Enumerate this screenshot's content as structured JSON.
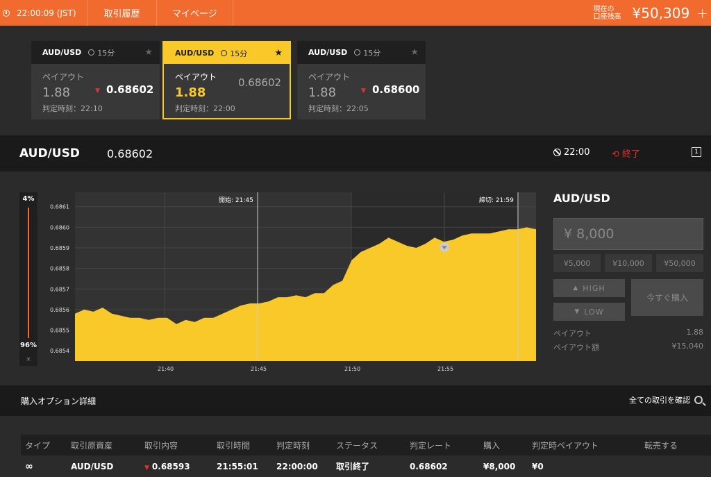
{
  "topbar": {
    "clock": "22:00:09 (JST)",
    "nav": [
      "取引履歴",
      "マイページ"
    ],
    "balance_label_1": "現在の",
    "balance_label_2": "口座残高",
    "balance": "¥50,309",
    "plus": "+"
  },
  "cards": [
    {
      "pair": "AUD/USD",
      "duration": "15分",
      "payout_label": "ペイアウト",
      "payout": "1.88",
      "rate": "0.68602",
      "judge": "判定時刻：22:10",
      "direction": "down",
      "active": false
    },
    {
      "pair": "AUD/USD",
      "duration": "15分",
      "payout_label": "ペイアウト",
      "payout": "1.88",
      "rate": "0.68602",
      "judge": "判定時刻：22:00",
      "direction": "none",
      "active": true
    },
    {
      "pair": "AUD/USD",
      "duration": "15分",
      "payout_label": "ペイアウト",
      "payout": "1.88",
      "rate": "0.68600",
      "judge": "判定時刻：22:05",
      "direction": "down",
      "active": false
    }
  ],
  "pairbar": {
    "pair": "AUD/USD",
    "rate": "0.68602",
    "expiry": "22:00",
    "status": "終了"
  },
  "meter": {
    "high_pct": "4%",
    "low_pct": "96%",
    "close": "×"
  },
  "chart_data": {
    "type": "area",
    "y_ticks": [
      "0.6861",
      "0.6860",
      "0.6859",
      "0.6858",
      "0.6857",
      "0.6856",
      "0.6855",
      "0.6854"
    ],
    "ylim": [
      0.68535,
      0.68617
    ],
    "x_ticks": [
      "21:40",
      "21:45",
      "21:50",
      "21:55"
    ],
    "start_label": "開始: 21:45",
    "end_label": "締切: 21:59",
    "x_minutes": [
      0,
      0.5,
      1,
      1.5,
      2,
      2.5,
      3,
      3.5,
      4,
      4.5,
      5,
      5.5,
      6,
      6.5,
      7,
      7.5,
      8,
      8.5,
      9,
      9.5,
      10,
      10.5,
      11,
      11.5,
      12,
      12.5,
      13,
      13.5,
      14,
      14.5,
      15,
      15.5,
      16,
      16.5,
      17,
      17.5,
      18,
      18.5,
      19,
      19.5,
      20,
      20.5,
      21,
      21.5,
      22,
      22.5,
      23,
      23.5,
      24,
      24.5,
      25
    ],
    "values": [
      0.68558,
      0.6856,
      0.68559,
      0.68561,
      0.68558,
      0.68557,
      0.68556,
      0.68556,
      0.68555,
      0.68556,
      0.68556,
      0.68553,
      0.68555,
      0.68554,
      0.68556,
      0.68556,
      0.68558,
      0.6856,
      0.68562,
      0.68563,
      0.68563,
      0.68564,
      0.68566,
      0.68566,
      0.68567,
      0.68566,
      0.68568,
      0.68568,
      0.68572,
      0.68574,
      0.68584,
      0.68588,
      0.6859,
      0.68592,
      0.68595,
      0.68593,
      0.68591,
      0.6859,
      0.68592,
      0.68595,
      0.68593,
      0.68594,
      0.68596,
      0.68597,
      0.68597,
      0.68597,
      0.68598,
      0.68599,
      0.68599,
      0.686,
      0.68599
    ],
    "marker": "0.68593"
  },
  "order": {
    "pair": "AUD/USD",
    "amount": "¥ 8,000",
    "chips": [
      "¥5,000",
      "¥10,000",
      "¥50,000"
    ],
    "high": "HIGH",
    "low": "LOW",
    "buy": "今すぐ購入",
    "payout_label": "ペイアウト",
    "payout": "1.88",
    "payout_amount_label": "ペイアウト額",
    "payout_amount": "¥15,040"
  },
  "detail": {
    "title": "購入オプション詳細",
    "all": "全ての取引を確認"
  },
  "table": {
    "headers": [
      "タイプ",
      "取引原資産",
      "取引内容",
      "取引時間",
      "判定時刻",
      "ステータス",
      "判定レート",
      "購入",
      "判定時ペイアウト",
      "転売する"
    ],
    "row": [
      "",
      "AUD/USD",
      "0.68593",
      "21:55:01",
      "22:00:00",
      "取引終了",
      "0.68602",
      "¥8,000",
      "¥0",
      ""
    ]
  },
  "colors": {
    "accent": "#f26b2e",
    "yellow": "#f9c829",
    "red": "#e0322e"
  }
}
